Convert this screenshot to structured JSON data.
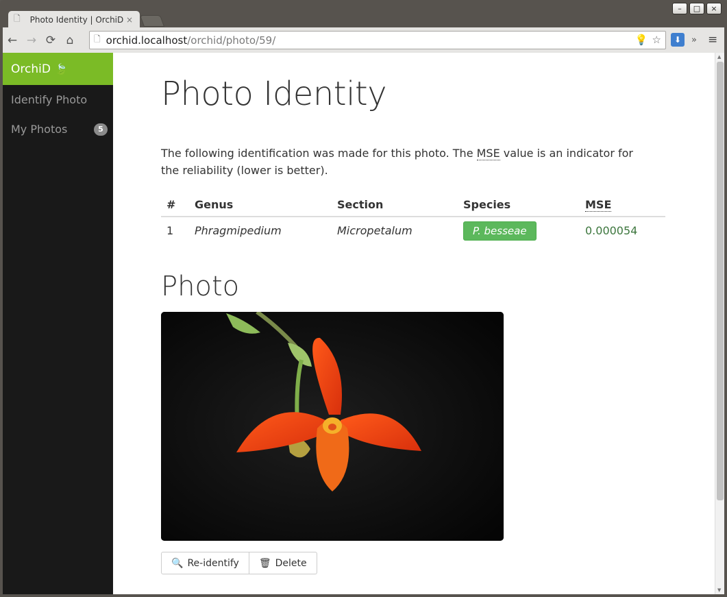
{
  "browser": {
    "tab_title": "Photo Identity | OrchiD",
    "tab_close": "×",
    "url_host": "orchid.localhost",
    "url_path": "/orchid/photo/59/",
    "back_icon": "←",
    "forward_icon": "→",
    "reload_icon": "⟳",
    "home_icon": "⌂",
    "page_icon": "🗋",
    "bulb_icon": "💡",
    "star_icon": "☆",
    "download_icon": "⬇",
    "more_icon": "»",
    "menu_icon": "≡",
    "win_minimize": "–",
    "win_maximize": "□",
    "win_close": "×"
  },
  "sidebar": {
    "brand": "OrchiD",
    "brand_icon": "🍃",
    "items": [
      {
        "label": "Identify Photo"
      },
      {
        "label": "My Photos",
        "badge": "5"
      }
    ]
  },
  "main": {
    "title": "Photo Identity",
    "intro_before": "The following identification was made for this photo. The ",
    "intro_abbr": "MSE",
    "intro_after": " value is an indicator for the reliability (lower is better).",
    "table": {
      "headers": [
        "#",
        "Genus",
        "Section",
        "Species",
        "MSE"
      ],
      "rows": [
        {
          "num": "1",
          "genus": "Phragmipedium",
          "section": "Micropetalum",
          "species": "P. besseae",
          "mse": "0.000054"
        }
      ]
    },
    "photo_heading": "Photo",
    "buttons": {
      "reidentify": "Re-identify",
      "delete": "Delete",
      "search_icon": "🔍",
      "trash_icon": "🗑"
    }
  },
  "colors": {
    "brand_green": "#7bbb26",
    "success_green": "#5cb85c",
    "sidebar_bg": "#191919"
  }
}
